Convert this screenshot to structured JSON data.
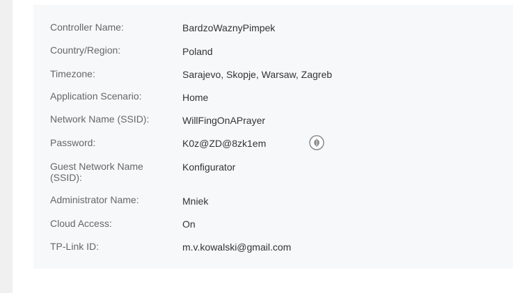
{
  "settings": [
    {
      "label": "Controller Name:",
      "value": "BardzoWaznyPimpek"
    },
    {
      "label": "Country/Region:",
      "value": "Poland"
    },
    {
      "label": "Timezone:",
      "value": "Sarajevo, Skopje, Warsaw, Zagreb"
    },
    {
      "label": "Application Scenario:",
      "value": "Home"
    },
    {
      "label": "Network Name (SSID):",
      "value": "WillFingOnAPrayer"
    },
    {
      "label": "Password:",
      "value": "K0z@ZD@8zk1em"
    },
    {
      "label": "Guest Network Name (SSID):",
      "value": "Konfigurator"
    },
    {
      "label": "Administrator Name:",
      "value": "Mniek"
    },
    {
      "label": "Cloud Access:",
      "value": "On"
    },
    {
      "label": "TP-Link ID:",
      "value": "m.v.kowalski@gmail.com"
    }
  ],
  "password_toggle_icon": "eye-hide-icon",
  "colors": {
    "panel_background": "#f7f8fa",
    "label_text": "#666666",
    "value_text": "#333333",
    "icon_gray": "#8a8a8a"
  }
}
